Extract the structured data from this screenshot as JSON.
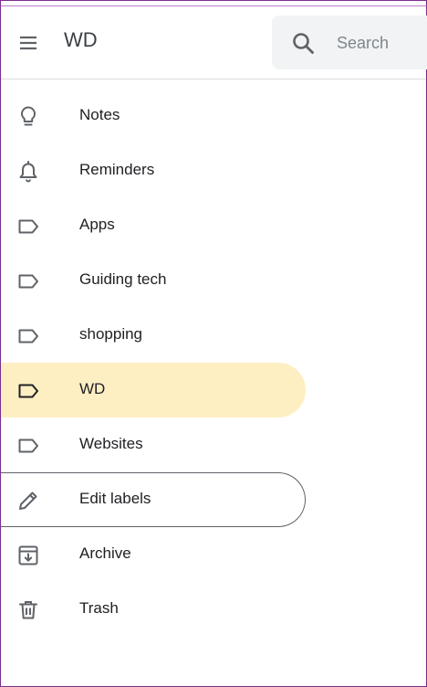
{
  "header": {
    "title": "WD",
    "search_placeholder": "Search"
  },
  "sidebar": {
    "items": [
      {
        "label": "Notes",
        "icon": "lightbulb-icon"
      },
      {
        "label": "Reminders",
        "icon": "bell-icon"
      },
      {
        "label": "Apps",
        "icon": "label-icon"
      },
      {
        "label": "Guiding tech",
        "icon": "label-icon"
      },
      {
        "label": "shopping",
        "icon": "label-icon"
      },
      {
        "label": "WD",
        "icon": "label-icon",
        "active": true
      },
      {
        "label": "Websites",
        "icon": "label-icon"
      },
      {
        "label": "Edit labels",
        "icon": "pencil-icon",
        "focused": true
      },
      {
        "label": "Archive",
        "icon": "archive-icon"
      },
      {
        "label": "Trash",
        "icon": "trash-icon"
      }
    ]
  },
  "colors": {
    "active_bg": "#feefc3",
    "icon": "#5f6368",
    "text": "#202124"
  }
}
